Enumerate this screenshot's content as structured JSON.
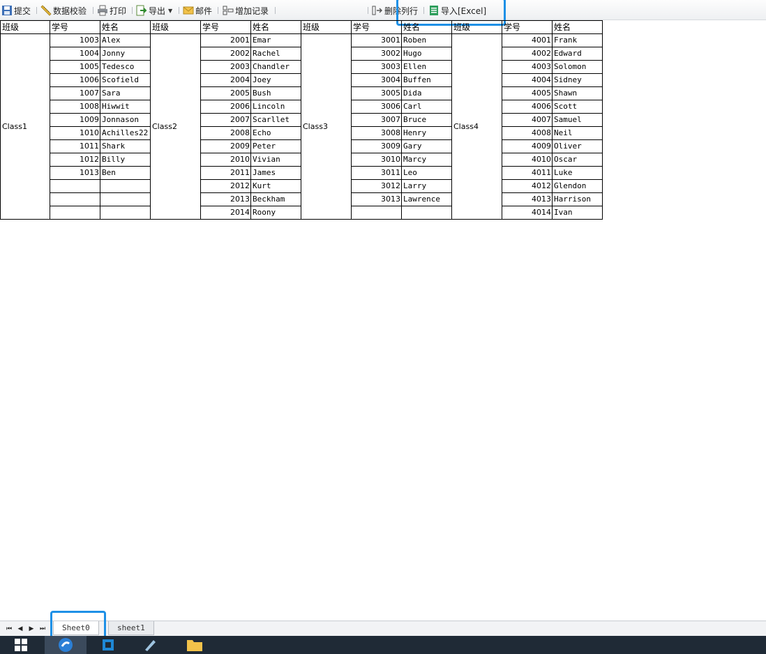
{
  "toolbar": {
    "submit": "提交",
    "validate": "数据校验",
    "print": "打印",
    "export": "导出",
    "mail": "邮件",
    "add_record": "增加记录",
    "delete_row": "删除列行",
    "import_excel": "导入[Excel]"
  },
  "headers": {
    "class": "班级",
    "id": "学号",
    "name": "姓名"
  },
  "groups": [
    {
      "class": "Class1",
      "ids": [
        "1003",
        "1004",
        "1005",
        "1006",
        "1007",
        "1008",
        "1009",
        "1010",
        "1011",
        "1012",
        "1013",
        "",
        ""
      ],
      "names": [
        "Alex",
        "Jonny",
        "Tedesco",
        "Scofield",
        "Sara",
        "Hiwwit",
        "Jonnason",
        "Achilles22",
        "Shark",
        "Billy",
        "Ben",
        "",
        ""
      ]
    },
    {
      "class": "Class2",
      "ids": [
        "2001",
        "2002",
        "2003",
        "2004",
        "2005",
        "2006",
        "2007",
        "2008",
        "2009",
        "2010",
        "2011",
        "2012",
        "2013",
        "2014"
      ],
      "names": [
        "Emar",
        "Rachel",
        "Chandler",
        "Joey",
        "Bush",
        "Lincoln",
        "Scarllet",
        "Echo",
        "Peter",
        "Vivian",
        "James",
        "Kurt",
        "Beckham",
        "Roony"
      ]
    },
    {
      "class": "Class3",
      "ids": [
        "3001",
        "3002",
        "3003",
        "3004",
        "3005",
        "3006",
        "3007",
        "3008",
        "3009",
        "3010",
        "3011",
        "3012",
        "3013",
        ""
      ],
      "names": [
        "Roben",
        "Hugo",
        "Ellen",
        "Buffen",
        "Dida",
        "Carl",
        "Bruce",
        "Henry",
        "Gary",
        "Marcy",
        "Leo",
        "Larry",
        "Lawrence",
        ""
      ]
    },
    {
      "class": "Class4",
      "ids": [
        "4001",
        "4002",
        "4003",
        "4004",
        "4005",
        "4006",
        "4007",
        "4008",
        "4009",
        "4010",
        "4011",
        "4012",
        "4013",
        "4014"
      ],
      "names": [
        "Frank",
        "Edward",
        "Solomon",
        "Sidney",
        "Shawn",
        "Scott",
        "Samuel",
        "Neil",
        "Oliver",
        "Oscar",
        "Luke",
        "Glendon",
        "Harrison",
        "Ivan"
      ]
    }
  ],
  "sheet_tabs": [
    "Sheet0",
    "sheet1"
  ],
  "colors": {
    "highlight": "#1e90e6",
    "taskbar": "#1f2a36"
  }
}
